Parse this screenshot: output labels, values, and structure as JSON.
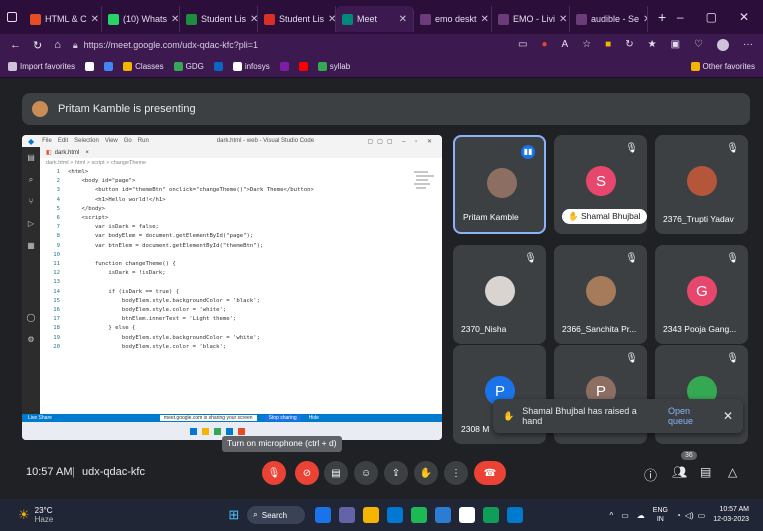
{
  "tabs": [
    {
      "label": "HTML & C",
      "color": "#e44d26"
    },
    {
      "label": "(10) Whats",
      "color": "#25d366"
    },
    {
      "label": "Student Lis",
      "color": "#1e8e3e"
    },
    {
      "label": "Student Lis",
      "color": "#d93025"
    },
    {
      "label": "Meet",
      "color": "#00897b"
    },
    {
      "label": "emo deskt",
      "color": "#6a3d7a"
    },
    {
      "label": "EMO - Livi",
      "color": "#6a3d7a"
    },
    {
      "label": "audible - Se",
      "color": "#6a3d7a"
    }
  ],
  "address": {
    "url": "https://meet.google.com/udx-qdac-kfc?pli=1"
  },
  "bookmarks": [
    {
      "label": "Import favorites",
      "color": "#cfc2da"
    },
    {
      "label": "",
      "color": "#ffffff"
    },
    {
      "label": "",
      "color": "#4285f4"
    },
    {
      "label": "Classes",
      "color": "#f4b400"
    },
    {
      "label": "GDG",
      "color": "#34a853"
    },
    {
      "label": "",
      "color": "#0a66c2"
    },
    {
      "label": "infosys",
      "color": "#ffffff"
    },
    {
      "label": "",
      "color": "#7b1fa2"
    },
    {
      "label": "",
      "color": "#ff0000"
    },
    {
      "label": "syllab",
      "color": "#34a853"
    }
  ],
  "other_favorites": "Other favorites",
  "presenting_text": "Pritam Kamble is presenting",
  "vscode": {
    "title": "dark.html - web - Visual Studio Code",
    "menu": [
      "File",
      "Edit",
      "Selection",
      "View",
      "Go",
      "Run"
    ],
    "tab": "dark.html",
    "breadcrumb": "dark.html > html > script > changeTheme",
    "lines": [
      {
        "n": "1",
        "t": "<html>"
      },
      {
        "n": "2",
        "t": "    <body id=\"page\">"
      },
      {
        "n": "3",
        "t": "        <button id=\"themeBtn\" onclick=\"changeTheme()\">Dark Theme</button>"
      },
      {
        "n": "4",
        "t": "        <h1>Hello world!</h1>"
      },
      {
        "n": "5",
        "t": "    </body>"
      },
      {
        "n": "6",
        "t": "    <script>"
      },
      {
        "n": "7",
        "t": "        var isDark = false;"
      },
      {
        "n": "8",
        "t": "        var bodyElem = document.getElementById(\"page\");"
      },
      {
        "n": "9",
        "t": "        var btnElem = document.getElementById(\"themeBtn\");"
      },
      {
        "n": "10",
        "t": ""
      },
      {
        "n": "11",
        "t": "        function changeTheme() {"
      },
      {
        "n": "12",
        "t": "            isDark = !isDark;"
      },
      {
        "n": "13",
        "t": ""
      },
      {
        "n": "14",
        "t": "            if (isDark == true) {"
      },
      {
        "n": "15",
        "t": "                bodyElem.style.backgroundColor = 'black';"
      },
      {
        "n": "16",
        "t": "                bodyElem.style.color = 'white';"
      },
      {
        "n": "17",
        "t": "                btnElem.innerText = 'Light theme';"
      },
      {
        "n": "18",
        "t": "            } else {"
      },
      {
        "n": "19",
        "t": "                bodyElem.style.backgroundColor = 'white';"
      },
      {
        "n": "20",
        "t": "                bodyElem.style.color = 'black';"
      }
    ],
    "status": "Live Share",
    "share_notice": "meet.google.com is sharing your screen",
    "stop_sharing": "Stop sharing",
    "hide": "Hide"
  },
  "participants": [
    {
      "name": "Pritam Kamble",
      "initial": "",
      "color": "#8d6e63",
      "speaking": true,
      "muted": false
    },
    {
      "name": "Shamal Bhujbal",
      "initial": "S",
      "color": "#e8476d",
      "speaking": false,
      "muted": true
    },
    {
      "name": "2376_Trupti Yadav",
      "initial": "",
      "color": "#b5563a",
      "speaking": false,
      "muted": true
    },
    {
      "name": "2370_Nisha",
      "initial": "",
      "color": "#d9d4cf",
      "speaking": false,
      "muted": true
    },
    {
      "name": "2366_Sanchita Pr...",
      "initial": "",
      "color": "#a67b5b",
      "speaking": false,
      "muted": true
    },
    {
      "name": "2343 Pooja Gang...",
      "initial": "G",
      "color": "#e8476d",
      "speaking": false,
      "muted": true
    },
    {
      "name": "2308 M",
      "initial": "P",
      "color": "#1a73e8",
      "speaking": false,
      "muted": false
    },
    {
      "name": "",
      "initial": "P",
      "color": "#8d6e63",
      "speaking": false,
      "muted": true
    },
    {
      "name": "",
      "initial": "",
      "color": "#34a853",
      "speaking": false,
      "muted": true
    }
  ],
  "toast": {
    "text": "Shamal Bhujbal has raised a hand",
    "action": "Open queue"
  },
  "tooltip": "Turn on microphone (ctrl + d)",
  "meeting": {
    "time": "10:57 AM",
    "code": "udx-qdac-kfc",
    "people_count": "36"
  },
  "taskbar": {
    "weather_temp": "23°C",
    "weather_desc": "Haze",
    "search": "Search",
    "lang": "ENG",
    "lang2": "IN",
    "time": "10:57 AM",
    "date": "12-03-2023"
  },
  "colors": {
    "end_call": "#ea4335",
    "accent": "#8ab4f8",
    "chrome_purple": "#3c1a50"
  }
}
